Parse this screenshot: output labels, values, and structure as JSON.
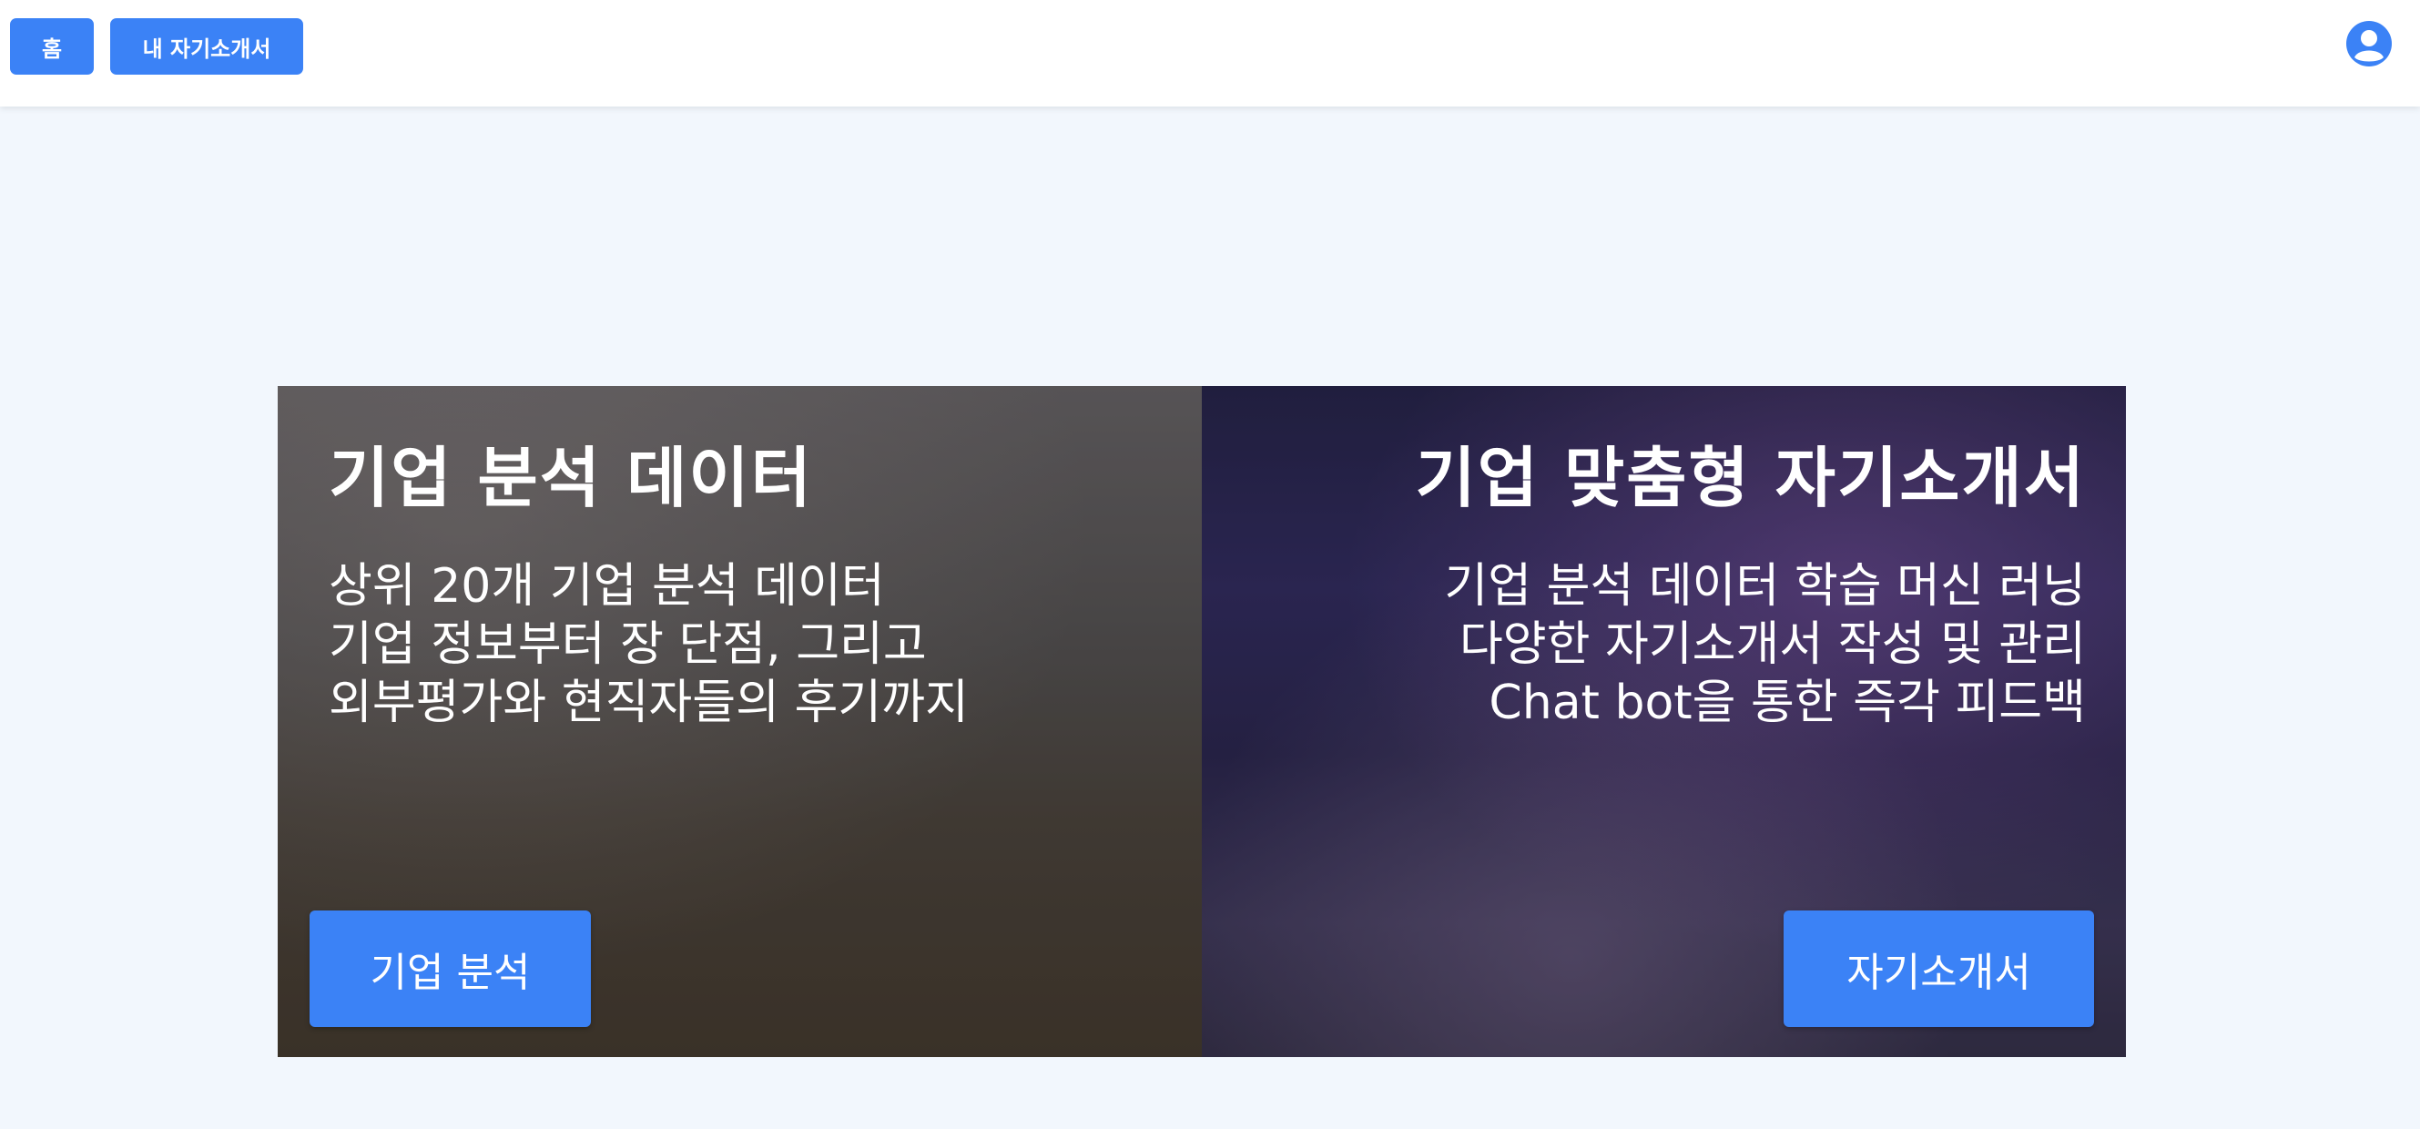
{
  "header": {
    "home_label": "홈",
    "my_essays_label": "내 자기소개서",
    "profile_icon": "user-circle-icon"
  },
  "colors": {
    "accent": "#3b82f6",
    "page_bg": "#f2f7fd"
  },
  "cards": {
    "left": {
      "title": "기업 분석 데이터",
      "desc": [
        "상위 20개 기업 분석 데이터",
        "기업 정보부터 장 단점, 그리고",
        "외부평가와 현직자들의 후기까지"
      ],
      "button_label": "기업 분석"
    },
    "right": {
      "title": "기업 맞춤형 자기소개서",
      "desc": [
        "기업 분석 데이터 학습 머신 러닝",
        "다양한 자기소개서 작성 및 관리",
        "Chat bot을 통한 즉각 피드백"
      ],
      "button_label": "자기소개서"
    }
  }
}
